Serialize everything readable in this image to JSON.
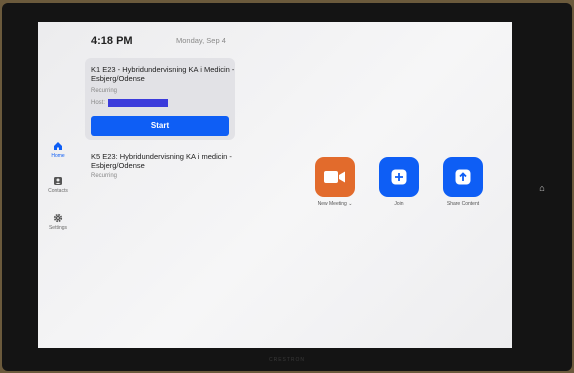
{
  "status": {
    "time": "4:18 PM",
    "date": "Monday, Sep 4"
  },
  "sidebar": {
    "items": [
      {
        "label": "Home",
        "icon": "home-icon",
        "active": true
      },
      {
        "label": "Contacts",
        "icon": "contacts-icon",
        "active": false
      },
      {
        "label": "Settings",
        "icon": "settings-icon",
        "active": false
      }
    ]
  },
  "meetings": [
    {
      "title": "K1 E23 - Hybridundervisning KA i Medicin - Esbjerg/Odense",
      "recurrence": "Recurring",
      "host_label": "Host:",
      "start_label": "Start"
    },
    {
      "title": "K5 E23: Hybridundervisning KA i medicin - Esbjerg/Odense",
      "recurrence": "Recurring"
    }
  ],
  "actions": {
    "new_meeting": {
      "label": "New Meeting",
      "icon": "video-camera-icon"
    },
    "join": {
      "label": "Join",
      "icon": "plus-icon"
    },
    "share": {
      "label": "Share Content",
      "icon": "upload-arrow-icon"
    }
  },
  "device": {
    "brand": "CRESTRON"
  },
  "colors": {
    "accent": "#0e5ef5",
    "orange": "#e26b2c"
  }
}
